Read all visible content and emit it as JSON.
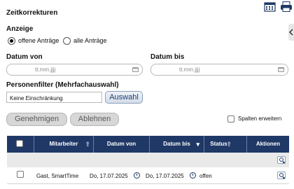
{
  "page": {
    "title": "Zeitkorrekturen",
    "anzeige_label": "Anzeige",
    "radio_open": "offene Anträge",
    "radio_all": "alle Anträge",
    "datum_von_label": "Datum von",
    "datum_bis_label": "Datum bis",
    "date_placeholder": "tt.mm.jjjj",
    "personenfilter_label": "Personenfilter (Mehrfachauswahl)",
    "personenfilter_value": "Keine Einschränkung",
    "auswahl_button": "Auswahl",
    "genehmigen_button": "Genehmigen",
    "ablehnen_button": "Ablehnen",
    "spalten_label": "Spalten erweitern"
  },
  "table": {
    "headers": {
      "mitarbeiter": "Mitarbeiter",
      "datum_von": "Datum von",
      "datum_bis": "Datum bis",
      "status": "Status",
      "aktionen": "Aktionen"
    },
    "rows": [
      {
        "mitarbeiter": "Gast, SmartTime",
        "datum_von": "Do, 17.07.2025",
        "datum_bis": "Do, 17.07.2025",
        "status": "offen"
      }
    ]
  },
  "icons": {
    "calendar": "calendar-icon",
    "print": "printer-icon",
    "search": "search-icon",
    "clock": "clock-icon"
  },
  "colors": {
    "header_bg": "#1f3866",
    "button_text": "#1d3f74"
  }
}
